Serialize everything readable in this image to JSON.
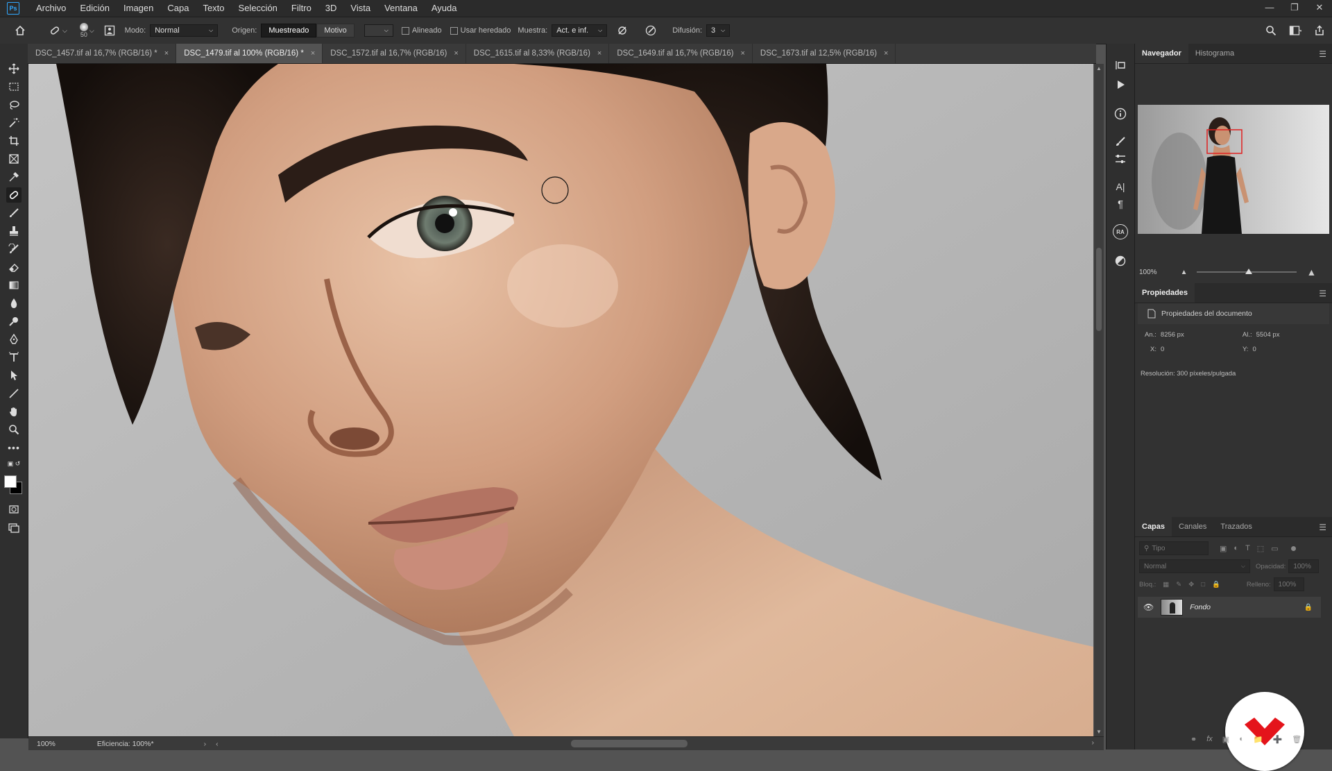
{
  "app": {
    "logo_text": "Ps"
  },
  "menu": [
    "Archivo",
    "Edición",
    "Imagen",
    "Capa",
    "Texto",
    "Selección",
    "Filtro",
    "3D",
    "Vista",
    "Ventana",
    "Ayuda"
  ],
  "options": {
    "brush_size": "50",
    "mode_label": "Modo:",
    "mode_value": "Normal",
    "source_label": "Origen:",
    "source_sampled": "Muestreado",
    "source_pattern": "Motivo",
    "aligned_label": "Alineado",
    "legacy_label": "Usar heredado",
    "sample_label": "Muestra:",
    "sample_value": "Act. e inf.",
    "diffusion_label": "Difusión:",
    "diffusion_value": "3"
  },
  "tabs": [
    {
      "label": "DSC_1457.tif al 16,7% (RGB/16) *",
      "active": false
    },
    {
      "label": "DSC_1479.tif al 100% (RGB/16) *",
      "active": true
    },
    {
      "label": "DSC_1572.tif al 16,7% (RGB/16)",
      "active": false
    },
    {
      "label": "DSC_1615.tif al 8,33% (RGB/16)",
      "active": false
    },
    {
      "label": "DSC_1649.tif al 16,7% (RGB/16)",
      "active": false
    },
    {
      "label": "DSC_1673.tif al 12,5% (RGB/16)",
      "active": false
    }
  ],
  "status": {
    "zoom": "100%",
    "efficiency": "Eficiencia: 100%*"
  },
  "navigator": {
    "tabs": [
      "Navegador",
      "Histograma"
    ],
    "zoom": "100%"
  },
  "properties": {
    "title": "Propiedades",
    "doc_label": "Propiedades del documento",
    "width_label": "An.:",
    "width_value": "8256 px",
    "height_label": "Al.:",
    "height_value": "5504 px",
    "x_label": "X:",
    "x_value": "0",
    "y_label": "Y:",
    "y_value": "0",
    "resolution": "Resolución: 300 píxeles/pulgada"
  },
  "layers": {
    "tabs": [
      "Capas",
      "Canales",
      "Trazados"
    ],
    "search_placeholder": "Tipo",
    "blend_mode": "Normal",
    "opacity_label": "Opacidad:",
    "opacity_value": "100%",
    "lock_label": "Bloq.:",
    "fill_label": "Relleno:",
    "fill_value": "100%",
    "items": [
      {
        "name": "Fondo",
        "visible": true,
        "locked": true
      }
    ]
  },
  "colors": {
    "accent": "#31a8ff",
    "brand_red": "#e4141b"
  }
}
